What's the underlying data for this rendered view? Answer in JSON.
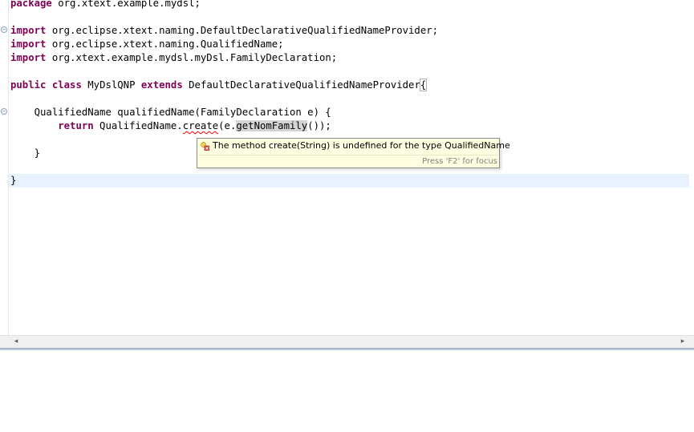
{
  "editor": {
    "lines": {
      "l1_kw": "package",
      "l1_rest": " org.xtext.example.mydsl;",
      "l3_kw": "import",
      "l3_rest": " org.eclipse.xtext.naming.DefaultDeclarativeQualifiedNameProvider;",
      "l4_kw": "import",
      "l4_rest": " org.eclipse.xtext.naming.QualifiedName;",
      "l5_kw": "import",
      "l5_rest": " org.xtext.example.mydsl.myDsl.FamilyDeclaration;",
      "l7_kw1": "public",
      "l7_kw2": "class",
      "l7_name": " MyDslQNP ",
      "l7_kw3": "extends",
      "l7_rest": " DefaultDeclarativeQualifiedNameProvider",
      "l7_brace": "{",
      "l9": "    QualifiedName qualifiedName(FamilyDeclaration e) {",
      "l10_indent": "        ",
      "l10_kw": "return",
      "l10_a": " QualifiedName.",
      "l10_err": "create",
      "l10_b": "(e.",
      "l10_occ": "getNomFamily",
      "l10_c": "());",
      "l12": "    }",
      "l14": "}"
    }
  },
  "hover": {
    "message": "The method create(String) is undefined for the type QualifiedName",
    "footer": "Press 'F2' for focus",
    "icon": "error-quickfix-icon"
  },
  "scrollbar": {
    "left": "◂",
    "right": "▸"
  },
  "fold_markers": {
    "import": "−",
    "method": "−"
  },
  "colors": {
    "keyword": "#7f0055",
    "current_line": "#e8f2fe",
    "hover_bg": "#ffffe1",
    "error": "#ff0000"
  }
}
